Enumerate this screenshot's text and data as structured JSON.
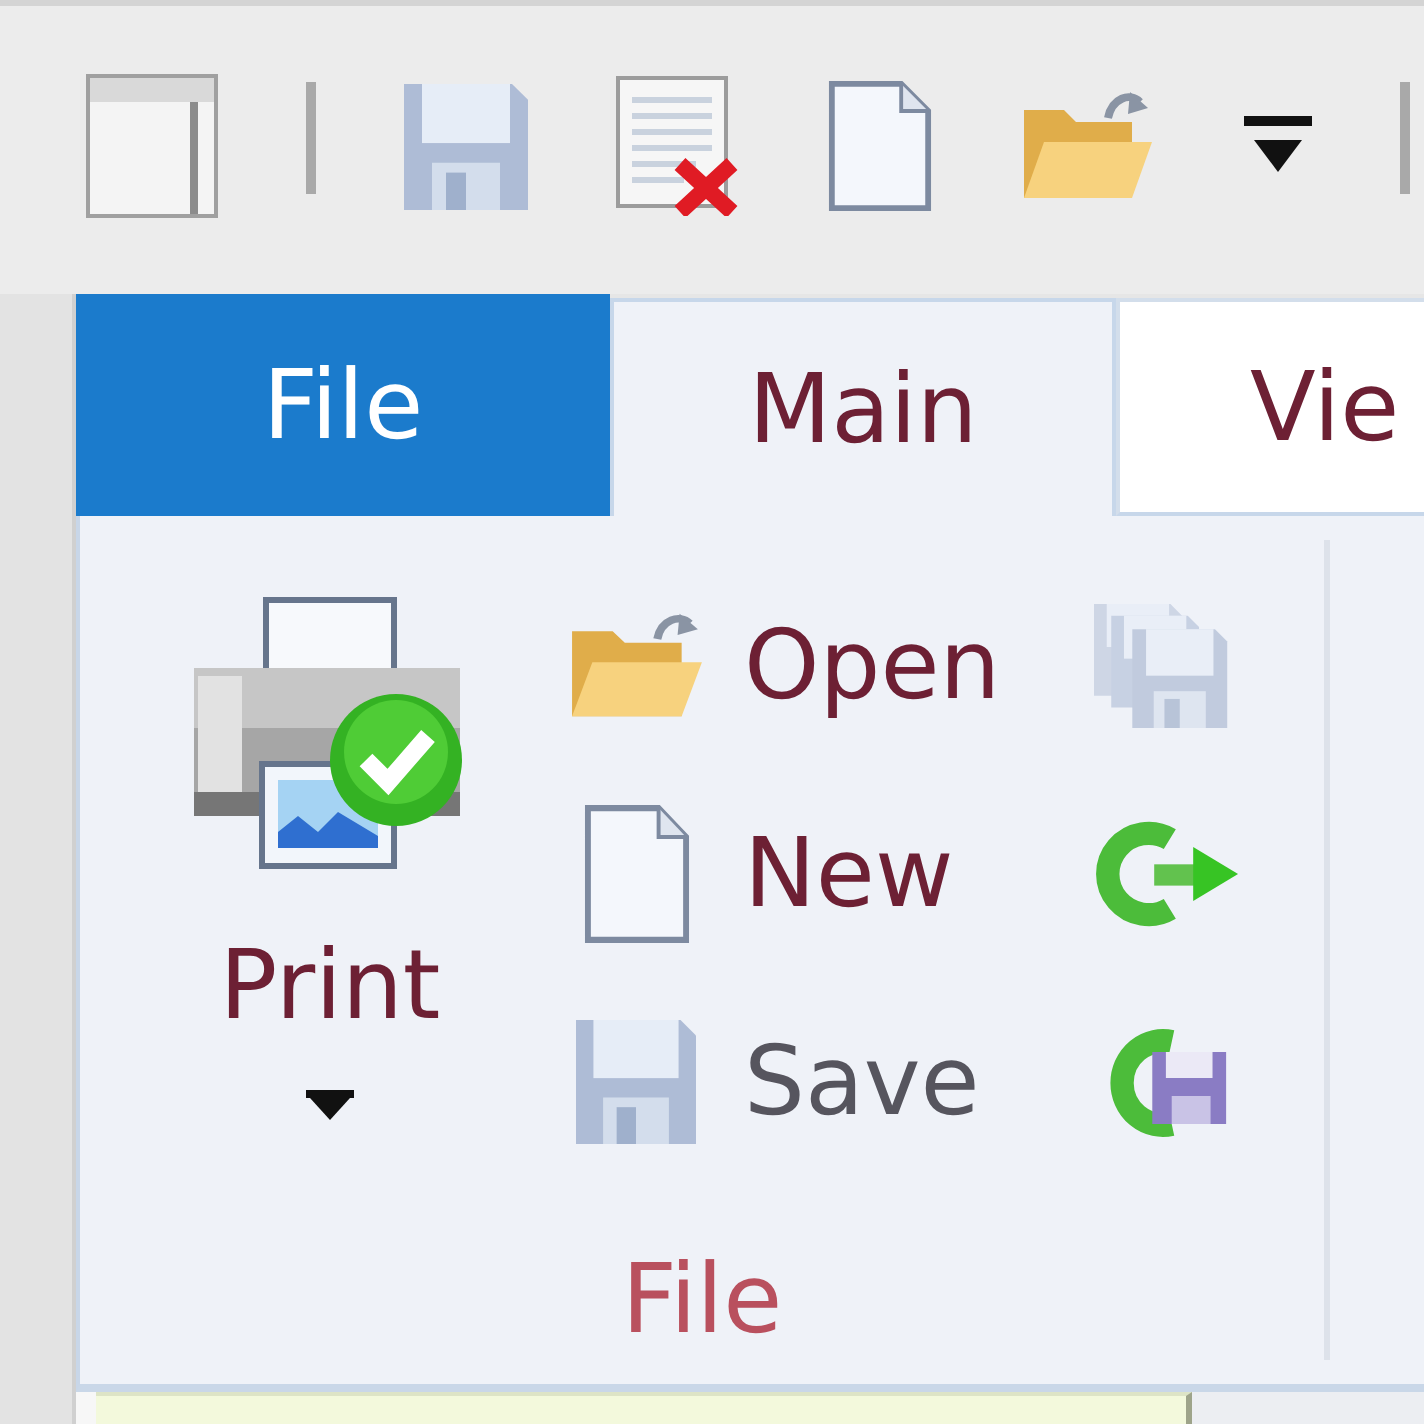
{
  "quick_access_toolbar": {
    "items": [
      {
        "kind": "window"
      },
      {
        "kind": "separator"
      },
      {
        "kind": "save"
      },
      {
        "kind": "delete"
      },
      {
        "kind": "new"
      },
      {
        "kind": "open"
      },
      {
        "kind": "customize"
      },
      {
        "kind": "separator"
      }
    ]
  },
  "tabs": [
    {
      "label": "File",
      "kind": "backstage",
      "selected": false
    },
    {
      "label": "Main",
      "kind": "tab",
      "selected": true
    },
    {
      "label": "Vie",
      "kind": "tab",
      "selected": false
    }
  ],
  "ribbon": {
    "groups": [
      {
        "label": "File",
        "large_buttons": [
          {
            "label": "Print",
            "kind": "print",
            "dropdown": true
          }
        ],
        "buttons": [
          {
            "label": "Open",
            "kind": "open",
            "disabled": false
          },
          {
            "label": "New",
            "kind": "new",
            "disabled": false
          },
          {
            "label": "Save",
            "kind": "save",
            "disabled": true
          }
        ],
        "icon_buttons": [
          {
            "kind": "save-all",
            "disabled": true
          },
          {
            "kind": "refresh",
            "disabled": false
          },
          {
            "kind": "save-refresh",
            "disabled": false
          }
        ]
      }
    ]
  }
}
